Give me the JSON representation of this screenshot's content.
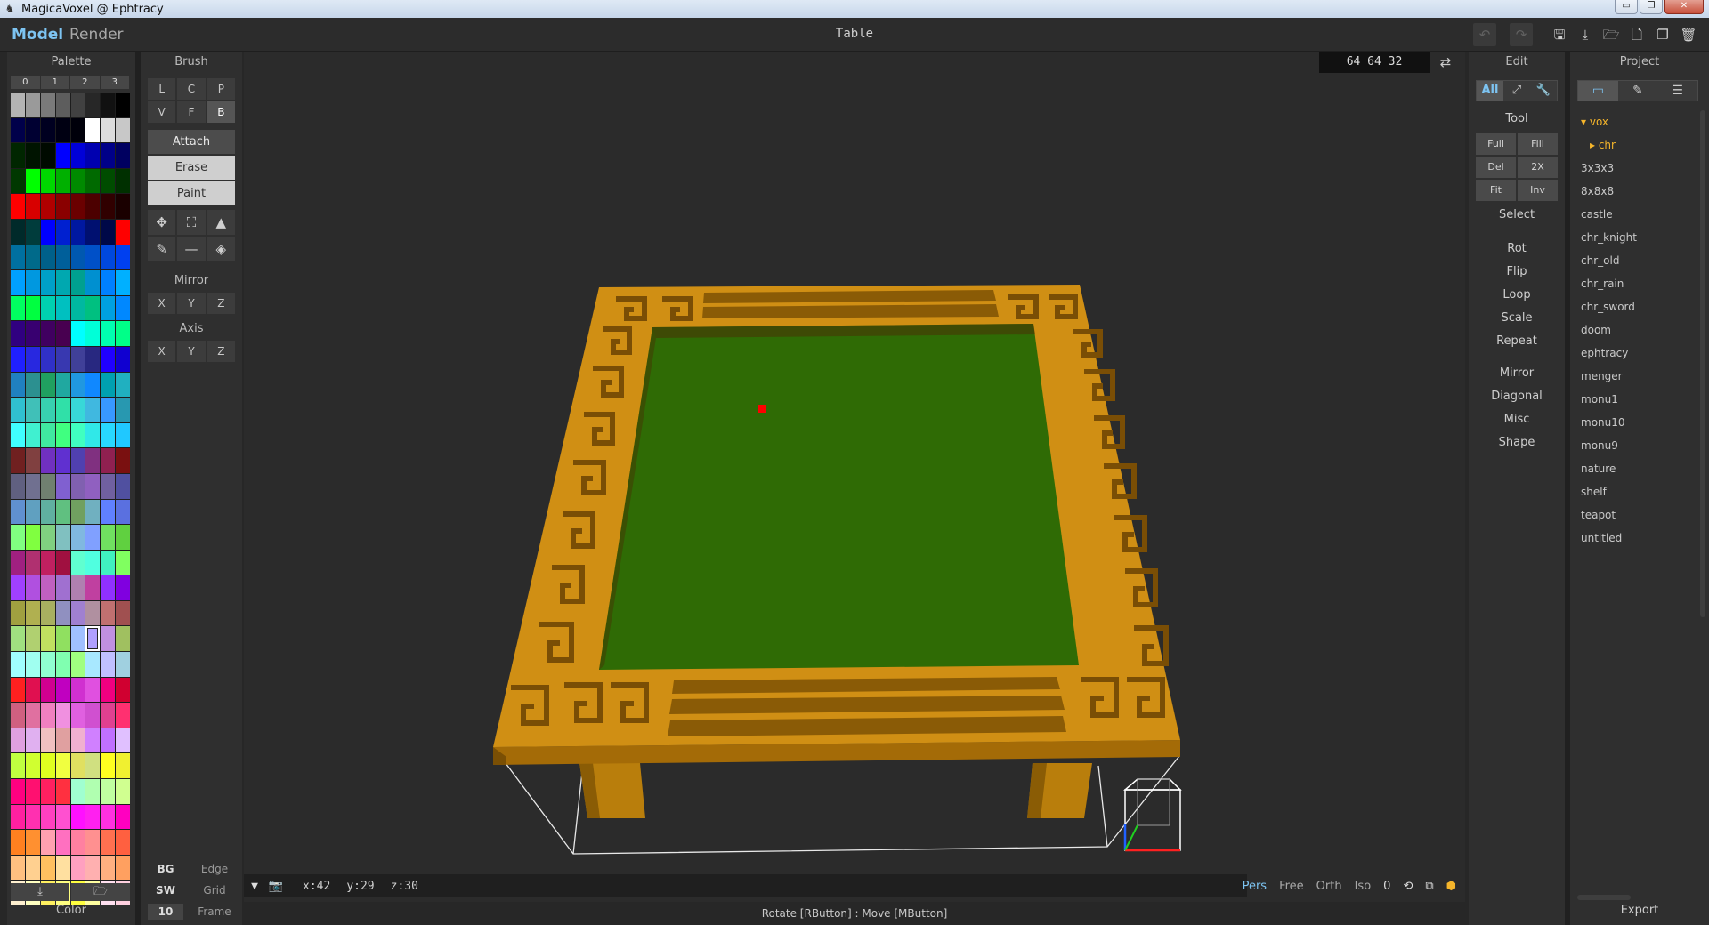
{
  "window": {
    "title": "MagicaVoxel @ Ephtracy",
    "minimize": "▭",
    "maximize": "❐",
    "close": "✕"
  },
  "topbar": {
    "mode_model": "Model",
    "mode_render": "Render",
    "document_title": "Table"
  },
  "palette": {
    "title": "Palette",
    "tabs": [
      "0",
      "1",
      "2",
      "3"
    ],
    "selected_index": 173,
    "colors": [
      "#b4b4b4",
      "#9a9a9a",
      "#7a7a7a",
      "#5d5d5d",
      "#414141",
      "#272727",
      "#111111",
      "#000000",
      "#00004a",
      "#000032",
      "#000020",
      "#000012",
      "#00000a",
      "#ffffff",
      "#dcdcdc",
      "#c8c8c8",
      "#002600",
      "#001400",
      "#000a00",
      "#0000ff",
      "#0000d8",
      "#0000b0",
      "#000088",
      "#000060",
      "#003800",
      "#00ff00",
      "#00d800",
      "#00b000",
      "#008a00",
      "#006a00",
      "#004c00",
      "#003000",
      "#ff0000",
      "#d80000",
      "#b00000",
      "#8a0000",
      "#6a0000",
      "#4c0000",
      "#300000",
      "#1a0000",
      "#002a2a",
      "#003c3c",
      "#0000ff",
      "#0020d0",
      "#0018a0",
      "#001070",
      "#000848",
      "#ff0000",
      "#0070a0",
      "#006a8a",
      "#00608a",
      "#005f9a",
      "#0058b0",
      "#0050c8",
      "#0048dd",
      "#0040f0",
      "#00a0ff",
      "#0098e0",
      "#00a0c8",
      "#00a8b0",
      "#00a090",
      "#0090d0",
      "#0080ff",
      "#00b0ff",
      "#00ff60",
      "#00ff40",
      "#00d0b0",
      "#00c0c0",
      "#00b8a0",
      "#00c080",
      "#00a0e0",
      "#0088ff",
      "#300080",
      "#380070",
      "#400060",
      "#480050",
      "#00ffff",
      "#00ffd8",
      "#00ffb0",
      "#00ff88",
      "#2020ff",
      "#2828e0",
      "#3030c8",
      "#3838b0",
      "#404098",
      "#282880",
      "#2000ff",
      "#1000d0",
      "#2080c0",
      "#2c9090",
      "#20a060",
      "#20a8a0",
      "#2098e0",
      "#1088ff",
      "#00a0b0",
      "#20b0c0",
      "#30c0d0",
      "#40c0b8",
      "#38d0b0",
      "#30e0a8",
      "#38d8d8",
      "#40b8e0",
      "#3898ff",
      "#2898b0",
      "#40ffff",
      "#40f0d0",
      "#40e8a0",
      "#40ff80",
      "#40ffc0",
      "#30e8e8",
      "#28d8ff",
      "#20c8ff",
      "#702020",
      "#804040",
      "#7030c0",
      "#6030d0",
      "#5040b0",
      "#803080",
      "#902050",
      "#7a1010",
      "#606080",
      "#707090",
      "#708070",
      "#8060d0",
      "#8060b0",
      "#9060c0",
      "#7060a0",
      "#5050a0",
      "#6090d0",
      "#60a0c0",
      "#60b0a0",
      "#60c080",
      "#70a060",
      "#70b0c0",
      "#6080ff",
      "#5a70e0",
      "#80ff80",
      "#80ff40",
      "#80d080",
      "#80c0c0",
      "#80b8e0",
      "#80a0ff",
      "#70e060",
      "#60d040",
      "#a02080",
      "#b03070",
      "#c02060",
      "#a01040",
      "#60ffd0",
      "#50ffe0",
      "#40f0c0",
      "#80ff60",
      "#a040ff",
      "#b050e0",
      "#c060c0",
      "#a070d0",
      "#b080b0",
      "#c040a0",
      "#9030ff",
      "#8000e0",
      "#a0a040",
      "#b0b050",
      "#a8b060",
      "#9090c0",
      "#a080d0",
      "#b090a0",
      "#c07070",
      "#a05050",
      "#a0e080",
      "#b0d070",
      "#c0e060",
      "#90e060",
      "#a0c0ff",
      "#b0a0ff",
      "#c090e0",
      "#a0c060",
      "#a0ffff",
      "#a0fff0",
      "#90ffd0",
      "#80ffb0",
      "#a0ff80",
      "#a8e8ff",
      "#c0c0ff",
      "#a0d0e0",
      "#ff2020",
      "#e01050",
      "#d00090",
      "#c000c0",
      "#d030d0",
      "#e050e0",
      "#f00080",
      "#d00030",
      "#d06080",
      "#e070a0",
      "#f080c0",
      "#f090e0",
      "#e060e0",
      "#d050d0",
      "#e04090",
      "#ff3070",
      "#e0a0e0",
      "#e0b0f0",
      "#f0c0c0",
      "#e0a0a0",
      "#f0b0d0",
      "#d080ff",
      "#c070ff",
      "#e0c0ff",
      "#c0ff40",
      "#d0ff30",
      "#e0ff20",
      "#f0ff40",
      "#e0e060",
      "#d0e080",
      "#ffff20",
      "#f0f030",
      "#ff0080",
      "#ff1070",
      "#ff2060",
      "#ff3040",
      "#a0ffd0",
      "#b0ffb0",
      "#c0ffa0",
      "#d0ff90",
      "#ff20a0",
      "#ff30b0",
      "#ff40c0",
      "#ff50d0",
      "#ff10ff",
      "#ff20f0",
      "#ff30e0",
      "#ff00c0",
      "#ff8020",
      "#ff9030",
      "#ffa0b0",
      "#ff70c0",
      "#ff80a0",
      "#ff9090",
      "#ff7050",
      "#ff6040",
      "#ffc080",
      "#ffd090",
      "#ffc060",
      "#ffe0a0",
      "#ffa0c0",
      "#ffb0b0",
      "#ffb080",
      "#ffa060",
      "#fff0d0",
      "#ffffc0",
      "#fff060",
      "#ffff80",
      "#ffff40",
      "#ffffa0",
      "#ffe0f0",
      "#ffd0e0"
    ],
    "footer": {
      "import_icon": "⤓",
      "open_icon": "🗁",
      "label": "Color"
    }
  },
  "brush": {
    "title": "Brush",
    "row1": [
      "L",
      "C",
      "P"
    ],
    "row2": [
      "V",
      "F",
      "B"
    ],
    "attach": "Attach",
    "erase": "Erase",
    "paint": "Paint",
    "tool_icons_row1": [
      "✥",
      "⛶",
      "▲"
    ],
    "tool_icons_row2": [
      "✎",
      "—",
      "◈"
    ],
    "mirror_label": "Mirror",
    "mirror": [
      "X",
      "Y",
      "Z"
    ],
    "axis_label": "Axis",
    "axis": [
      "X",
      "Y",
      "Z"
    ],
    "bg": "BG",
    "edge": "Edge",
    "sw": "SW",
    "grid": "Grid",
    "frame_value": "10",
    "frame": "Frame"
  },
  "viewport": {
    "dimensions": "64  64  32",
    "swap_icon": "⇄",
    "cursor": {
      "x": "x:42",
      "y": "y:29",
      "z": "z:30"
    },
    "menu_icon": "▼",
    "camera_icon": "📷",
    "views": [
      "Pers",
      "Free",
      "Orth",
      "Iso"
    ],
    "active_view": "Pers",
    "zoom_value": "0",
    "status": "Rotate [RButton] : Move [MButton]"
  },
  "edit": {
    "title": "Edit",
    "tabs": [
      "All",
      "⤢",
      "🔧"
    ],
    "tool_label": "Tool",
    "tool_buttons": [
      "Full",
      "Fill",
      "Del",
      "2X",
      "Fit",
      "Inv"
    ],
    "select": "Select",
    "ops1": [
      "Rot",
      "Flip",
      "Loop",
      "Scale",
      "Repeat"
    ],
    "ops2": [
      "Mirror",
      "Diagonal",
      "Misc",
      "Shape"
    ]
  },
  "project": {
    "title": "Project",
    "tabs": [
      "▭",
      "✎",
      "☰"
    ],
    "folder": "▾ vox",
    "subfolder": "▸ chr",
    "files": [
      "3x3x3",
      "8x8x8",
      "castle",
      "chr_knight",
      "chr_old",
      "chr_rain",
      "chr_sword",
      "doom",
      "ephtracy",
      "menger",
      "monu1",
      "monu10",
      "monu9",
      "nature",
      "shelf",
      "teapot",
      "untitled"
    ],
    "export": "Export"
  },
  "colors": {
    "accent": "#7dc4f2",
    "wood": "#c98a12",
    "felt": "#3a7a08",
    "folder": "#f5b52b"
  }
}
